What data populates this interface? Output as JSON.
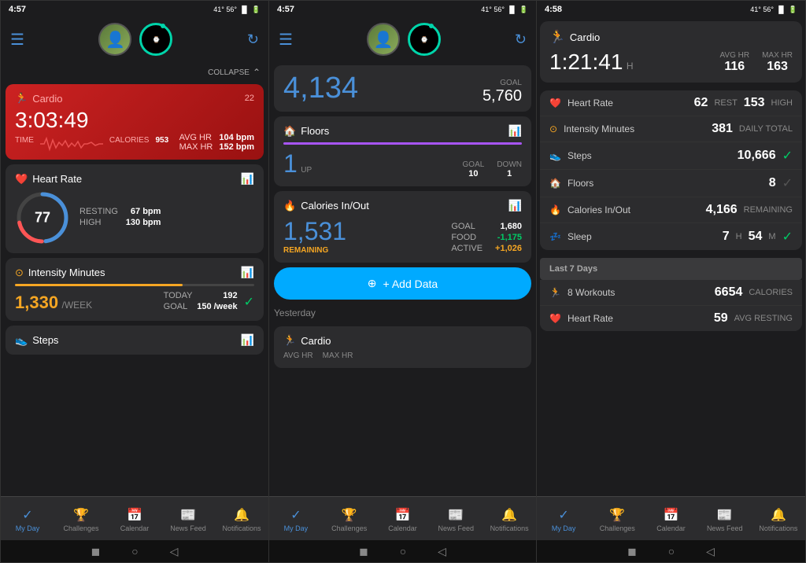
{
  "screens": [
    {
      "id": "screen1",
      "status_time": "4:57",
      "status_extras": "41° 56°",
      "header": {
        "menu_label": "☰",
        "sync_label": "↻"
      },
      "collapse_label": "COLLAPSE",
      "cardio": {
        "title": "Cardio",
        "icon": "🏃",
        "time": "3:03:49",
        "avg_hr_label": "AVG HR",
        "avg_hr_val": "104 bpm",
        "max_hr_label": "MAX HR",
        "max_hr_val": "152 bpm",
        "time_label": "TIME",
        "calories_label": "CALORIES",
        "calories_val": "953"
      },
      "heart_rate": {
        "title": "Heart Rate",
        "icon": "❤️",
        "value": "77",
        "resting_label": "RESTING",
        "resting_val": "67 bpm",
        "high_label": "HIGH",
        "high_val": "130 bpm"
      },
      "intensity": {
        "title": "Intensity Minutes",
        "icon": "⚡",
        "main_val": "1,330",
        "unit": "/WEEK",
        "today_label": "TODAY",
        "today_val": "192",
        "goal_label": "GOAL",
        "goal_val": "150 /week"
      },
      "steps": {
        "title": "Steps",
        "icon": "👟"
      },
      "nav": {
        "items": [
          {
            "label": "My Day",
            "icon": "✓",
            "active": true
          },
          {
            "label": "Challenges",
            "icon": "🏆",
            "active": false
          },
          {
            "label": "Calendar",
            "icon": "📅",
            "active": false
          },
          {
            "label": "News Feed",
            "icon": "📰",
            "active": false
          },
          {
            "label": "Notifications",
            "icon": "🔔",
            "active": false
          }
        ]
      }
    },
    {
      "id": "screen2",
      "status_time": "4:57",
      "status_extras": "41° 56°",
      "top_steps": {
        "value": "4,134",
        "goal_label": "GOAL",
        "goal_val": "5,760"
      },
      "floors": {
        "title": "Floors",
        "icon": "🏠",
        "up_val": "1",
        "up_label": "UP",
        "goal_label": "GOAL",
        "goal_val": "10",
        "down_label": "DOWN",
        "down_val": "1"
      },
      "calories": {
        "title": "Calories In/Out",
        "icon": "🔥",
        "main_val": "1,531",
        "remaining_label": "REMAINING",
        "goal_label": "GOAL",
        "goal_val": "1,680",
        "food_label": "FOOD",
        "food_val": "-1,175",
        "active_label": "ACTIVE",
        "active_val": "+1,026"
      },
      "add_data_label": "+ Add Data",
      "yesterday_label": "Yesterday",
      "yesterday_cardio": {
        "title": "Cardio",
        "icon": "🏃",
        "avg_hr_label": "AVG HR",
        "max_hr_label": "MAX HR"
      },
      "nav": {
        "items": [
          {
            "label": "My Day",
            "icon": "✓",
            "active": true
          },
          {
            "label": "Challenges",
            "icon": "🏆",
            "active": false
          },
          {
            "label": "Calendar",
            "icon": "📅",
            "active": false
          },
          {
            "label": "News Feed",
            "icon": "📰",
            "active": false
          },
          {
            "label": "Notifications",
            "icon": "🔔",
            "active": false
          }
        ]
      }
    },
    {
      "id": "screen3",
      "status_time": "4:58",
      "status_extras": "41° 56°",
      "cardio": {
        "title": "Cardio",
        "icon": "🏃",
        "time": "1:21:41",
        "time_unit": "H",
        "avg_hr_label": "AVG HR",
        "avg_hr_val": "116",
        "max_hr_label": "MAX HR",
        "max_hr_val": "163"
      },
      "list_items": [
        {
          "icon": "❤️",
          "label": "Heart Rate",
          "value": "62",
          "unit": "REST",
          "extra": "153",
          "extra_unit": "HIGH",
          "check": "none"
        },
        {
          "icon": "⚡",
          "label": "Intensity Minutes",
          "value": "381",
          "unit": "DAILY TOTAL",
          "extra": "",
          "extra_unit": "",
          "check": "none"
        },
        {
          "icon": "👟",
          "label": "Steps",
          "value": "10,666",
          "unit": "",
          "extra": "",
          "extra_unit": "",
          "check": "green"
        },
        {
          "icon": "🏠",
          "label": "Floors",
          "value": "8",
          "unit": "",
          "extra": "",
          "extra_unit": "",
          "check": "dark"
        },
        {
          "icon": "🔥",
          "label": "Calories In/Out",
          "value": "4,166",
          "unit": "REMAINING",
          "extra": "",
          "extra_unit": "",
          "check": "none"
        },
        {
          "icon": "💤",
          "label": "Sleep",
          "value": "7",
          "unit": "H",
          "extra": "54",
          "extra_unit": "M",
          "check": "green"
        }
      ],
      "last7": {
        "title": "Last 7 Days",
        "items": [
          {
            "icon": "🏃",
            "label": "8 Workouts",
            "value": "6654",
            "unit": "CALORIES"
          },
          {
            "icon": "❤️",
            "label": "Heart Rate",
            "value": "59",
            "unit": "AVG RESTING"
          }
        ]
      },
      "nav": {
        "items": [
          {
            "label": "My Day",
            "icon": "✓",
            "active": true
          },
          {
            "label": "Challenges",
            "icon": "🏆",
            "active": false
          },
          {
            "label": "Calendar",
            "icon": "📅",
            "active": false
          },
          {
            "label": "News Feed",
            "icon": "📰",
            "active": false
          },
          {
            "label": "Notifications",
            "icon": "🔔",
            "active": false
          }
        ]
      }
    }
  ],
  "nav_labels": {
    "my_day": "My Day",
    "challenges": "Challenges",
    "calendar": "Calendar",
    "news_feed": "News Feed",
    "notifications": "Notifications"
  }
}
